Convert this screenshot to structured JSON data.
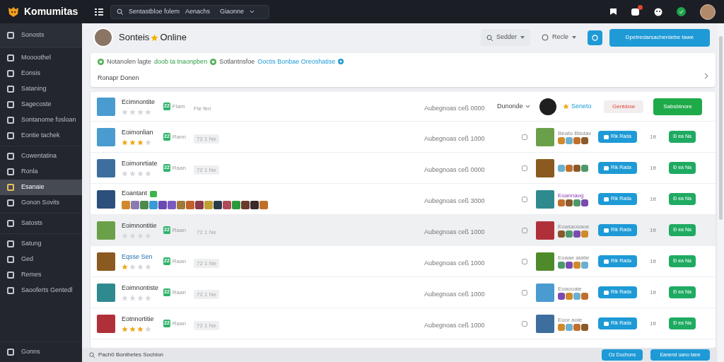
{
  "app": {
    "name": "Komumitas"
  },
  "topbar": {
    "search_text": "Sentastbloe folem",
    "filter_1": "Aenachs",
    "filter_2": "Giaonne"
  },
  "sidebar": {
    "groups": [
      {
        "items": [
          {
            "label": "Sonosts",
            "selected": false
          }
        ]
      },
      {
        "items": [
          {
            "label": "Moooothel",
            "selected": false
          },
          {
            "label": "Eonsis",
            "selected": false
          },
          {
            "label": "Sataning",
            "selected": false
          },
          {
            "label": "Sagecoste",
            "selected": false
          },
          {
            "label": "Sontanome fosloan",
            "selected": false
          },
          {
            "label": "Eontie tachek",
            "selected": false
          }
        ]
      },
      {
        "items": [
          {
            "label": "Cowentatina",
            "selected": false
          },
          {
            "label": "Ronla",
            "selected": false
          },
          {
            "label": "Esanaie",
            "selected": true
          },
          {
            "label": "Gonon Sovits",
            "selected": false
          }
        ]
      },
      {
        "items": [
          {
            "label": "Satosts",
            "selected": false
          }
        ]
      },
      {
        "items": [
          {
            "label": "Satung",
            "selected": false
          },
          {
            "label": "Ged",
            "selected": false
          },
          {
            "label": "Remes",
            "selected": false
          },
          {
            "label": "Saooferts Gentedl",
            "selected": false
          }
        ]
      },
      {
        "items": [
          {
            "label": "Gonns",
            "selected": false
          }
        ]
      }
    ]
  },
  "profile": {
    "name": "Sonteis",
    "status": "Online"
  },
  "toolbar": {
    "filter_1": "Sedder",
    "filter_2": "Recle",
    "primary_button": "Dpetredarsacherdebe tawe"
  },
  "notice": {
    "text_1": "Notanolen lagte",
    "link_1": "doob ta tnaonpben",
    "text_2": "Sotlantnsfoe",
    "link_2": "Ooctis Bonbae Oreoshatise",
    "subtext": "Ronapr Donen"
  },
  "header_row": {
    "name": "Ecimnontite",
    "stars": 0,
    "badge": "22",
    "badge_text": "Flam",
    "tag": "Fle fen",
    "date": "Aubegnoas ceß 0000",
    "sort": "Dunonde",
    "rating_label": "Seneto",
    "report_button": "Gentdow",
    "subscribe_button": "Sabsbinore"
  },
  "rows": [
    {
      "kind": "stars",
      "name": "Eoimonlian",
      "stars": 3,
      "badge": "22",
      "badge_text": "Rann",
      "tag": "72 1 Ne",
      "date": "Aubegnoas ceß 1000",
      "caption": "Beato Bisdav",
      "button": "Rik Rada",
      "count": "1tt",
      "action": "Ð ea Na",
      "selected": false
    },
    {
      "kind": "stars",
      "name": "Eoimonrtiate",
      "stars": 0,
      "badge": "22",
      "badge_text": "Raan",
      "tag": "72 1 Ne",
      "date": "Aubegnoas ceß 0000",
      "button": "Rik Rada",
      "count": "1tt",
      "action": "Ð ea Na",
      "selected": false
    },
    {
      "kind": "icons",
      "name": "Eoantant",
      "date": "Aubegnoas ceß 3000",
      "caption": "Eoannaog",
      "button": "Rik Rada",
      "count": "1tt",
      "action": "Ð ea Na",
      "selected": false
    },
    {
      "kind": "stars",
      "name": "Eoimnontitie",
      "stars": 0,
      "badge": "22",
      "badge_text": "Raan",
      "tag": "72 1 Ne",
      "date": "Aubegnoas ceß 1000",
      "caption": "Eoasaosaoe",
      "button": "Rik Rada",
      "count": "1tt",
      "action": "Ð ea Na",
      "selected": true
    },
    {
      "kind": "stars",
      "name": "Eqsse Sen",
      "stars": 1,
      "badge": "22",
      "badge_text": "Raan",
      "tag": "72 1 Ne",
      "date": "Aubegnoas ceß 1000",
      "caption": "Eoaae aiatie",
      "button": "Rik Rada",
      "count": "1tt",
      "action": "Ð ea Na",
      "selected": false
    },
    {
      "kind": "stars",
      "name": "Eoimnontiste",
      "stars": 0,
      "badge": "22",
      "badge_text": "Raan",
      "tag": "72 1 Ne",
      "date": "Aubegnoas ceß 1000",
      "caption": "Eoaooaie",
      "button": "Rik Rada",
      "count": "1tt",
      "action": "Ð ea Na",
      "selected": false
    },
    {
      "kind": "stars",
      "name": "Eotnnortitie",
      "stars": 3,
      "badge": "22",
      "badge_text": "Raan",
      "tag": "72 1 Ne",
      "date": "Aubegnoas ceß 1000",
      "caption": "Eoor aoie",
      "button": "Rik Rada",
      "count": "1tt",
      "action": "Ð ea Na",
      "selected": false
    }
  ],
  "bottom_bar": {
    "text": "Pach0 Bonthetes Sochion",
    "button_1": "Oz Dochons",
    "button_2": "Eanend oano tane"
  }
}
